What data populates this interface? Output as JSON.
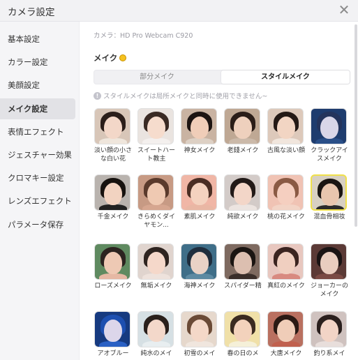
{
  "window": {
    "title": "カメラ設定",
    "close_symbol": "✕"
  },
  "sidebar": {
    "items": [
      {
        "label": "基本設定",
        "active": false
      },
      {
        "label": "カラー設定",
        "active": false
      },
      {
        "label": "美顔設定",
        "active": false
      },
      {
        "label": "メイク設定",
        "active": true
      },
      {
        "label": "表情エフェクト",
        "active": false
      },
      {
        "label": "ジェスチャー効果",
        "active": false
      },
      {
        "label": "クロマキー設定",
        "active": false
      },
      {
        "label": "レンズエフェクト",
        "active": false
      },
      {
        "label": "パラメータ保存",
        "active": false
      }
    ]
  },
  "main": {
    "camera_label": "カメラ：HD Pro Webcam C920",
    "section_title": "メイク",
    "tabs": [
      {
        "label": "部分メイク",
        "active": false
      },
      {
        "label": "スタイルメイク",
        "active": true
      }
    ],
    "notice": "スタイルメイクは局所メイクと同時に使用できません~",
    "styles": [
      {
        "label": "淡い顔の小さな白い花",
        "selected": false,
        "hair": "#2b1e1a",
        "skin": "#f3d7c8",
        "bg": "#d8c6b8",
        "body": "#efe6dc"
      },
      {
        "label": "スイートハート教主",
        "selected": false,
        "hair": "#3a2a24",
        "skin": "#f6dccd",
        "bg": "#eae4e0",
        "body": "#f4f0ee"
      },
      {
        "label": "神女メイク",
        "selected": false,
        "hair": "#1c1412",
        "skin": "#f0cdb8",
        "bg": "#c9b3a2",
        "body": "#ddd0c4"
      },
      {
        "label": "老錢メイク",
        "selected": false,
        "hair": "#2a1d18",
        "skin": "#eed0bd",
        "bg": "#bfa894",
        "body": "#cbb9a9"
      },
      {
        "label": "古風な淡い顔",
        "selected": false,
        "hair": "#241915",
        "skin": "#f2d5c3",
        "bg": "#ddc9bb",
        "body": "#f1e6dd"
      },
      {
        "label": "クラックアイスメイク",
        "selected": false,
        "hair": "#24345c",
        "skin": "#d9d6e8",
        "bg": "#1e3c6e",
        "body": "#2a4f88"
      },
      {
        "label": "千金メイク",
        "selected": false,
        "hair": "#17120f",
        "skin": "#f2d3c1",
        "bg": "#b9b3ae",
        "body": "#222222"
      },
      {
        "label": "きらめくダイヤモン...",
        "selected": false,
        "hair": "#5a3a2c",
        "skin": "#efc9b2",
        "bg": "#c79a84",
        "body": "#d6a690"
      },
      {
        "label": "素肌メイク",
        "selected": false,
        "hair": "#4a2e24",
        "skin": "#f4d2bf",
        "bg": "#f0b6a6",
        "body": "#e9b7a4"
      },
      {
        "label": "純欲メイク",
        "selected": false,
        "hair": "#221a18",
        "skin": "#f3d6c8",
        "bg": "#d3cbc8",
        "body": "#ece4e0"
      },
      {
        "label": "桃の花メイク",
        "selected": false,
        "hair": "#8a5a44",
        "skin": "#f5cfc0",
        "bg": "#f0c3b4",
        "body": "#f2d4c6"
      },
      {
        "label": "混血骨相妆",
        "selected": true,
        "hair": "#1a1512",
        "skin": "#e8c6ae",
        "bg": "#d8d0c2",
        "body": "#2b2b2b"
      },
      {
        "label": "ローズメイク",
        "selected": false,
        "hair": "#2c2420",
        "skin": "#eec9b4",
        "bg": "#5f8a60",
        "body": "#e6b8a4"
      },
      {
        "label": "無垢メイク",
        "selected": false,
        "hair": "#2e2420",
        "skin": "#f5d8ca",
        "bg": "#e0d4ce",
        "body": "#eee2dc"
      },
      {
        "label": "海神メイク",
        "selected": false,
        "hair": "#1f2e3e",
        "skin": "#e9d2c6",
        "bg": "#3f6e88",
        "body": "#5d8aa2"
      },
      {
        "label": "スパイダー精",
        "selected": false,
        "hair": "#1b1512",
        "skin": "#dcbfb0",
        "bg": "#7e6a60",
        "body": "#3a2e2a"
      },
      {
        "label": "真紅のメイク",
        "selected": false,
        "hair": "#3b2420",
        "skin": "#f0cfc0",
        "bg": "#e8c7bf",
        "body": "#d88a80"
      },
      {
        "label": "ジョーカーのメイク",
        "selected": false,
        "hair": "#1a1414",
        "skin": "#e9cdbf",
        "bg": "#5b3a36",
        "body": "#7a4a44"
      },
      {
        "label": "アオブルー",
        "selected": false,
        "hair": "#1d4fb0",
        "skin": "#dcd6ea",
        "bg": "#163a80",
        "body": "#2a60c4"
      },
      {
        "label": "純水のメイ",
        "selected": false,
        "hair": "#2a201c",
        "skin": "#f3d8ca",
        "bg": "#d6e0e4",
        "body": "#e8eef0"
      },
      {
        "label": "初雪のメイ",
        "selected": false,
        "hair": "#6a4a36",
        "skin": "#f4d8c8",
        "bg": "#e6d8cc",
        "body": "#f0e6de"
      },
      {
        "label": "春の日のメ",
        "selected": false,
        "hair": "#3a2a20",
        "skin": "#f3d2bc",
        "bg": "#f0e0a8",
        "body": "#f5f0d8"
      },
      {
        "label": "大唐メイク",
        "selected": false,
        "hair": "#2b1a14",
        "skin": "#f0cdb8",
        "bg": "#b97060",
        "body": "#c0604e"
      },
      {
        "label": "釣り系メイ",
        "selected": false,
        "hair": "#2a201e",
        "skin": "#f2d4c6",
        "bg": "#cfc2bf",
        "body": "#e8dedb"
      }
    ]
  },
  "colors": {
    "selected_border": "#f0e04a",
    "vip_badge": "#f5c220"
  }
}
